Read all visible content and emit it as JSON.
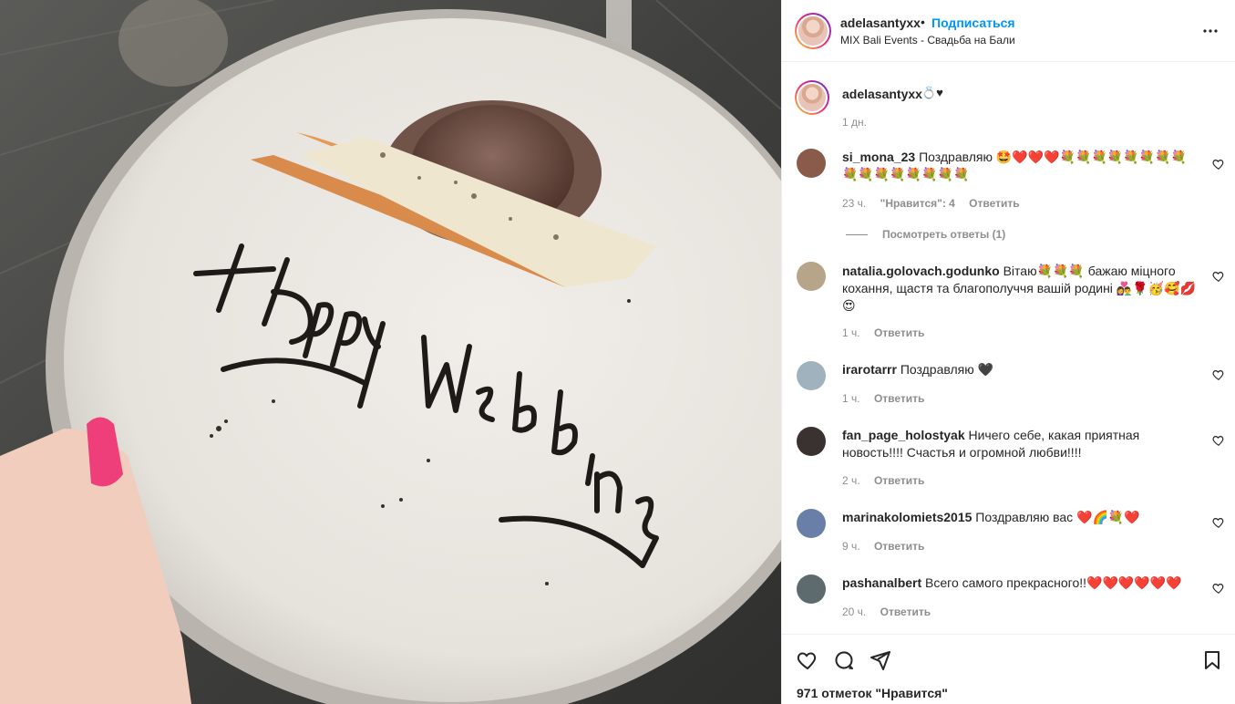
{
  "post": {
    "author": "adelasantyxx",
    "follow_label": "Подписаться",
    "separator": "•",
    "location": "MIX Bali Events - Свадьба на Бали",
    "photo_text": "Happy Wedding",
    "caption_user": "adelasantyxx",
    "caption_text": "💍♥",
    "caption_time": "1 дн.",
    "likes": "971 отметок \"Нравится\""
  },
  "comments": [
    {
      "user": "si_mona_23",
      "text": "Поздравляю 🤩❤️❤️❤️💐💐💐💐💐💐💐💐💐💐💐💐💐💐💐💐",
      "time": "23 ч.",
      "likes": "\"Нравится\": 4",
      "reply": "Ответить",
      "view_replies": "Посмотреть ответы (1)",
      "avatar_color": "#8a5a4a"
    },
    {
      "user": "natalia.golovach.godunko",
      "text": "Вітаю💐💐💐  бажаю міцного кохання, щастя та благополуччя вашій родині 👩‍❤️‍👨🌹🥳🥰💋😍",
      "time": "1 ч.",
      "reply": "Ответить",
      "avatar_color": "#b7a58a"
    },
    {
      "user": "irarotarrr",
      "text": "Поздравляю 🖤",
      "time": "1 ч.",
      "reply": "Ответить",
      "avatar_color": "#9fb2bd"
    },
    {
      "user": "fan_page_holostyak",
      "text": "Ничего себе, какая приятная новость!!!! Счастья и огромной любви!!!!",
      "time": "2 ч.",
      "reply": "Ответить",
      "avatar_color": "#3a3230"
    },
    {
      "user": "marinakolomiets2015",
      "text": "Поздравляю вас ❤️🌈💐❤️",
      "time": "9 ч.",
      "reply": "Ответить",
      "avatar_color": "#6a7fa8"
    },
    {
      "user": "pashanalbert",
      "text": "Всего самого прекрасного!!❤️❤️❤️❤️❤️❤️",
      "time": "20 ч.",
      "reply": "Ответить",
      "avatar_color": "#5d6b6f"
    }
  ],
  "icons": {
    "more": "more-options-icon",
    "like": "heart-icon",
    "comment": "comment-icon",
    "share": "share-icon",
    "save": "bookmark-icon"
  },
  "colors": {
    "accent": "#0095f6",
    "muted": "#8e8e8e",
    "text": "#262626"
  }
}
